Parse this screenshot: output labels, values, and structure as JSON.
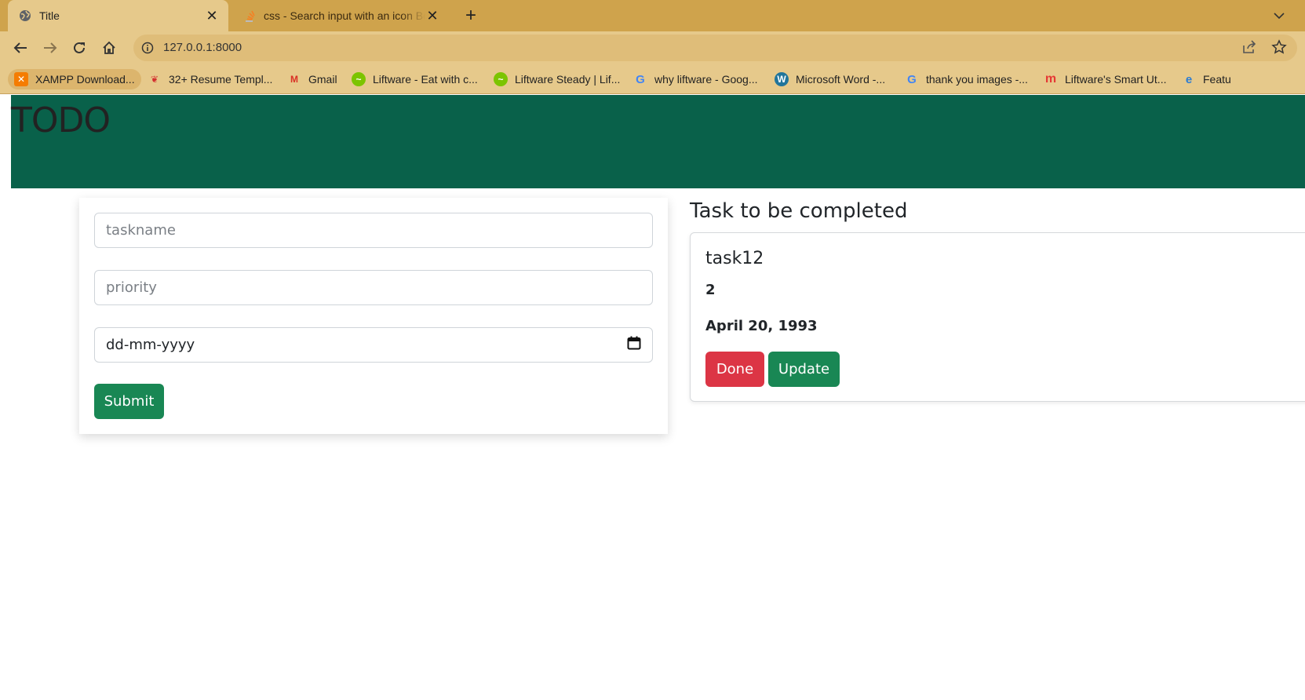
{
  "browser": {
    "tabs": [
      {
        "title": "Title",
        "active": true,
        "favicon": "globe-icon"
      },
      {
        "title": "css - Search input with an icon Bo",
        "active": false,
        "favicon": "stackoverflow-icon"
      }
    ],
    "new_tab_label": "+",
    "url": "127.0.0.1:8000",
    "bookmarks": [
      {
        "label": "XAMPP Download...",
        "icon": "xampp-icon",
        "color": "#f57c00"
      },
      {
        "label": "32+ Resume Templ...",
        "icon": "resume-icon",
        "color": "#d32f2f"
      },
      {
        "label": "Gmail",
        "icon": "gmail-icon",
        "color": "#d93025"
      },
      {
        "label": "Liftware - Eat with c...",
        "icon": "liftware-icon",
        "color": "#7cc400"
      },
      {
        "label": "Liftware Steady | Lif...",
        "icon": "liftware-icon",
        "color": "#7cc400"
      },
      {
        "label": "why liftware - Goog...",
        "icon": "google-icon",
        "color": "#4285f4"
      },
      {
        "label": "Microsoft Word -...",
        "icon": "wordpress-icon",
        "color": "#21759b"
      },
      {
        "label": "thank you images -...",
        "icon": "google-icon",
        "color": "#4285f4"
      },
      {
        "label": "Liftware's Smart Ut...",
        "icon": "m-brand-icon",
        "color": "#e53935"
      },
      {
        "label": "Featu",
        "icon": "edge-icon",
        "color": "#2b7cd3"
      }
    ]
  },
  "app": {
    "title": "TODO",
    "form": {
      "taskname_placeholder": "taskname",
      "priority_placeholder": "priority",
      "date_placeholder": "dd-mm-yyyy",
      "submit_label": "Submit"
    },
    "tasks_heading": "Task to be completed",
    "tasks": [
      {
        "name": "task12",
        "priority": "2",
        "date": "April 20, 1993",
        "done_label": "Done",
        "update_label": "Update"
      }
    ]
  },
  "colors": {
    "header_bg": "#09614a",
    "chrome_tabstrip": "#cfa34c",
    "chrome_toolbar": "#e6c98b",
    "success": "#198754",
    "danger": "#dc3545"
  }
}
